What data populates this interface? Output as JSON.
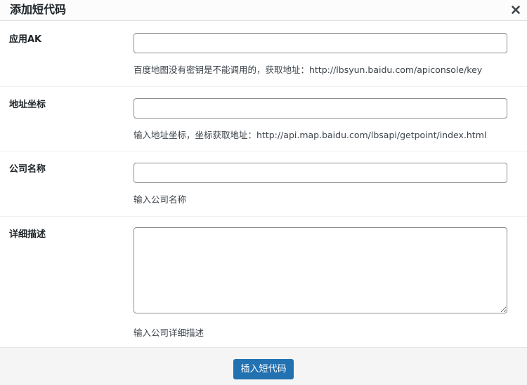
{
  "dialog": {
    "title": "添加短代码",
    "close_icon": "close-icon"
  },
  "fields": [
    {
      "label": "应用AK",
      "value": "",
      "description": "百度地图没有密钥是不能调用的，获取地址：http://lbsyun.baidu.com/apiconsole/key"
    },
    {
      "label": "地址坐标",
      "value": "",
      "description": "输入地址坐标，坐标获取地址：http://api.map.baidu.com/lbsapi/getpoint/index.html"
    },
    {
      "label": "公司名称",
      "value": "",
      "description": "输入公司名称"
    },
    {
      "label": "详细描述",
      "value": "",
      "description": "输入公司详细描述"
    }
  ],
  "footer": {
    "insert_label": "插入短代码"
  },
  "colors": {
    "accent": "#2271b1",
    "footer_bg": "#f5f5f5",
    "text": "#1d2327",
    "muted_text": "#3c434a",
    "border": "#8c8f94"
  }
}
